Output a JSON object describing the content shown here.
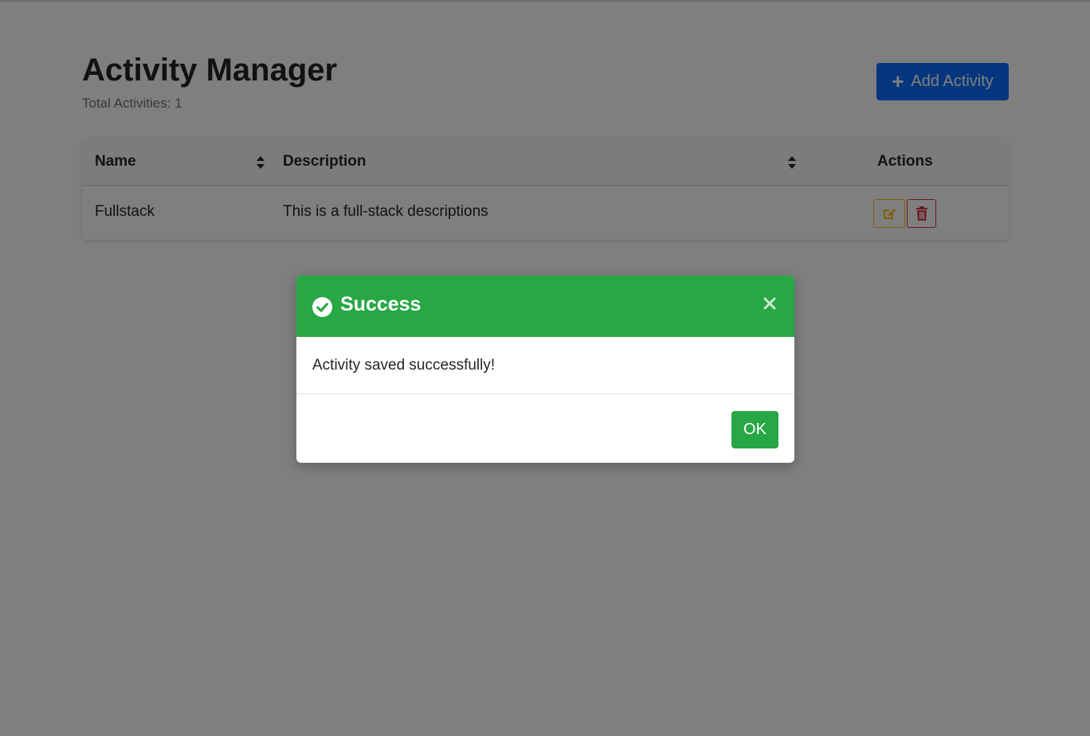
{
  "header": {
    "title": "Activity Manager",
    "total_activities": "Total Activities: 1",
    "add_button_label": "Add Activity"
  },
  "table": {
    "columns": {
      "name": "Name",
      "description": "Description",
      "actions": "Actions"
    },
    "rows": [
      {
        "name": "Fullstack",
        "description": "This is a full-stack descriptions"
      }
    ]
  },
  "modal": {
    "title": "Success",
    "message": "Activity saved successfully!",
    "ok_label": "OK"
  },
  "colors": {
    "primary": "#0d6efd",
    "success": "#28a745",
    "warning": "#ffc107",
    "danger": "#dc3545"
  },
  "icons": {
    "add": "plus-icon",
    "sort": "sort-icon",
    "edit": "edit-icon",
    "delete": "trash-icon",
    "success": "check-circle-icon",
    "close": "close-icon"
  }
}
